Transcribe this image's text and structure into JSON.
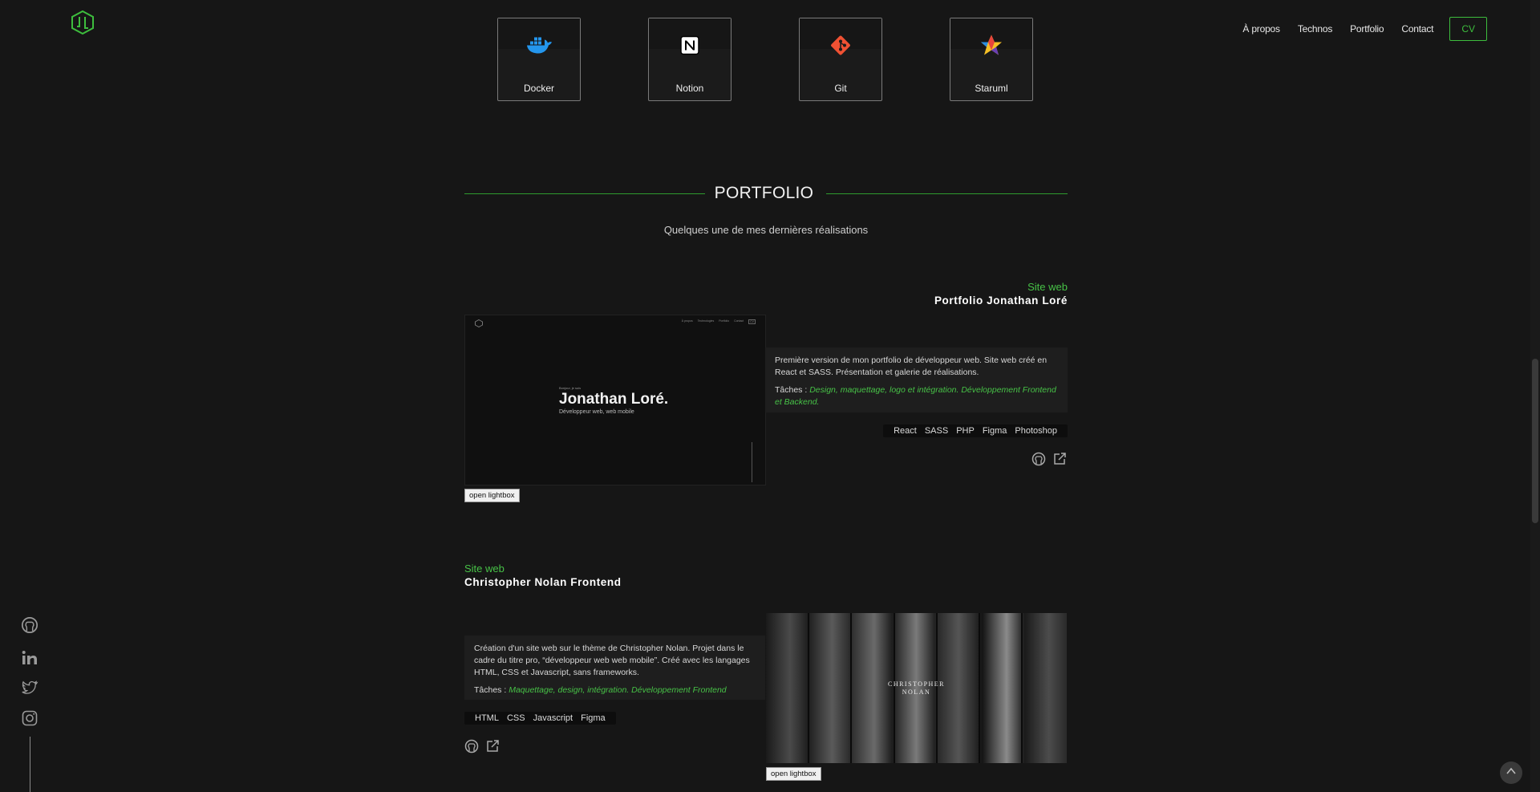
{
  "header": {
    "nav": [
      "À propos",
      "Technos",
      "Portfolio",
      "Contact"
    ],
    "cv_label": "CV"
  },
  "technos": [
    {
      "label": "Docker",
      "icon": "docker-icon"
    },
    {
      "label": "Notion",
      "icon": "notion-icon"
    },
    {
      "label": "Git",
      "icon": "git-icon"
    },
    {
      "label": "Staruml",
      "icon": "staruml-icon"
    }
  ],
  "portfolio": {
    "title": "PORTFOLIO",
    "subtitle": "Quelques une de mes dernières réalisations",
    "projects": [
      {
        "category": "Site web",
        "title": "Portfolio Jonathan Loré",
        "preview": {
          "nav": [
            "À propos",
            "Technologies",
            "Portfolio",
            "Contact",
            "CV"
          ],
          "small": "Bonjour, je suis",
          "name": "Jonathan Loré.",
          "role": "Développeur web, web mobile"
        },
        "description": "Première version de mon portfolio de développeur web. Site web créé en React et SASS. Présentation et galerie de réalisations.",
        "tasks_label": "Tâches :",
        "tasks": "Design, maquettage, logo et intégration. Développement Frontend et Backend.",
        "tags": [
          "React",
          "SASS",
          "PHP",
          "Figma",
          "Photoshop"
        ],
        "lightbox": "open lightbox"
      },
      {
        "category": "Site web",
        "title": "Christopher Nolan Frontend",
        "preview": {
          "name_line1": "CHRISTOPHER",
          "name_line2": "NOLAN"
        },
        "description": "Création d'un site web sur le thème de Christopher Nolan. Projet dans le cadre du titre pro, “développeur web web mobile”. Créé avec les langages HTML, CSS et Javascript, sans frameworks.",
        "tasks_label": "Tâches :",
        "tasks": "Maquettage, design, intégration. Développement Frontend",
        "tags": [
          "HTML",
          "CSS",
          "Javascript",
          "Figma"
        ],
        "lightbox": "open lightbox"
      }
    ]
  },
  "colors": {
    "accent": "#47c247",
    "background": "#161616"
  },
  "socials": [
    "github-icon",
    "linkedin-icon",
    "twitter-icon",
    "instagram-icon"
  ]
}
